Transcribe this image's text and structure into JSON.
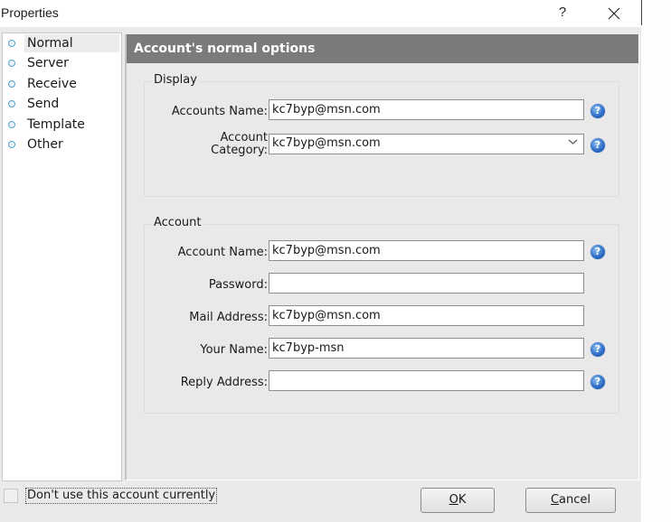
{
  "window": {
    "title": "Properties",
    "help_label": "?",
    "close_label": "✕"
  },
  "nav": {
    "items": [
      {
        "label": "Normal",
        "selected": true
      },
      {
        "label": "Server",
        "selected": false
      },
      {
        "label": "Receive",
        "selected": false
      },
      {
        "label": "Send",
        "selected": false
      },
      {
        "label": "Template",
        "selected": false
      },
      {
        "label": "Other",
        "selected": false
      }
    ]
  },
  "main": {
    "header": "Account's normal options",
    "display_group": {
      "title": "Display",
      "accounts_name_label": "Accounts Name:",
      "accounts_name_value": "kc7byp@msn.com",
      "account_category_label_line1": "Account",
      "account_category_label_line2": "Category:",
      "account_category_value": "kc7byp@msn.com"
    },
    "account_group": {
      "title": "Account",
      "account_name_label": "Account Name:",
      "account_name_value": "kc7byp@msn.com",
      "password_label": "Password:",
      "password_value": "",
      "mail_address_label": "Mail Address:",
      "mail_address_value": "kc7byp@msn.com",
      "your_name_label": "Your Name:",
      "your_name_value": "kc7byp-msn",
      "reply_address_label": "Reply Address:",
      "reply_address_value": ""
    },
    "help_glyph": "?"
  },
  "footer": {
    "disable_checkbox_label": "Don't use this account currently",
    "disable_checked": false,
    "ok_mnemonic": "O",
    "ok_rest": "K",
    "cancel_mnemonic": "C",
    "cancel_rest": "ancel"
  },
  "colors": {
    "header_bg": "#7b7b7b",
    "panel_bg": "#e9e9e9",
    "help_icon": "#2f6fc8"
  }
}
